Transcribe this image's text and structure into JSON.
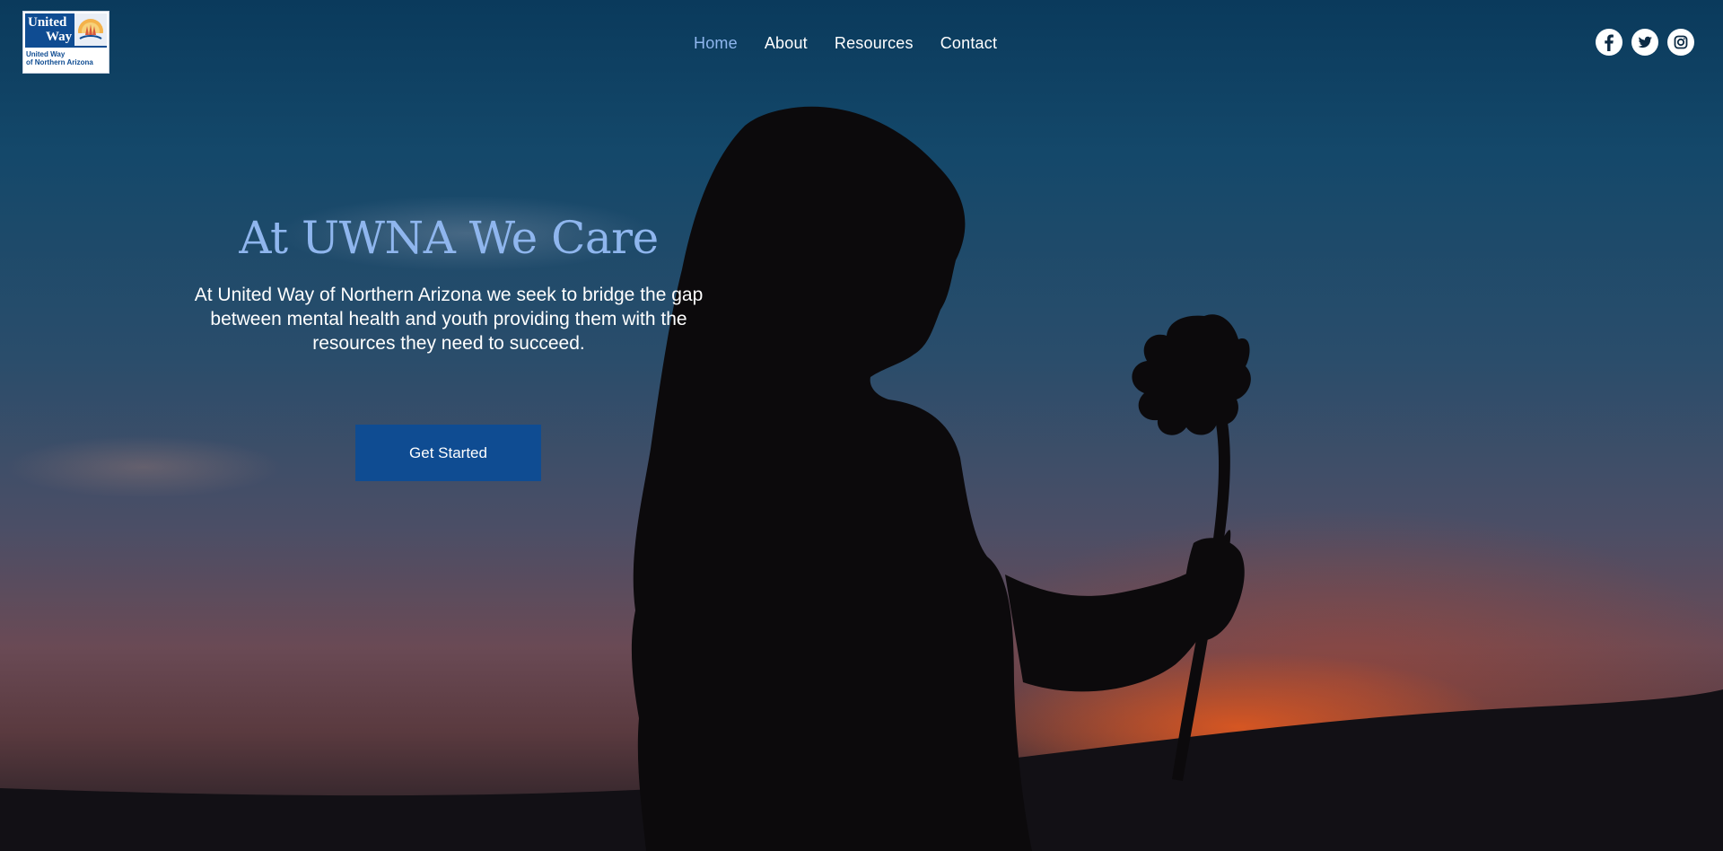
{
  "logo": {
    "title_line1": "United",
    "title_line2": "Way",
    "subtitle_line1": "United Way",
    "subtitle_line2": "of Northern Arizona"
  },
  "nav": {
    "items": [
      {
        "label": "Home",
        "active": true
      },
      {
        "label": "About",
        "active": false
      },
      {
        "label": "Resources",
        "active": false
      },
      {
        "label": "Contact",
        "active": false
      }
    ]
  },
  "social": {
    "icons": [
      "facebook-icon",
      "twitter-icon",
      "instagram-icon"
    ]
  },
  "hero": {
    "title": "At UWNA We Care",
    "description": "At United Way of Northern Arizona we seek to bridge the gap between mental health and youth providing them with the resources they need to succeed.",
    "cta_label": "Get Started"
  },
  "colors": {
    "accent": "#8fb6ee",
    "brand_blue": "#0f4c92",
    "text": "#ffffff"
  }
}
